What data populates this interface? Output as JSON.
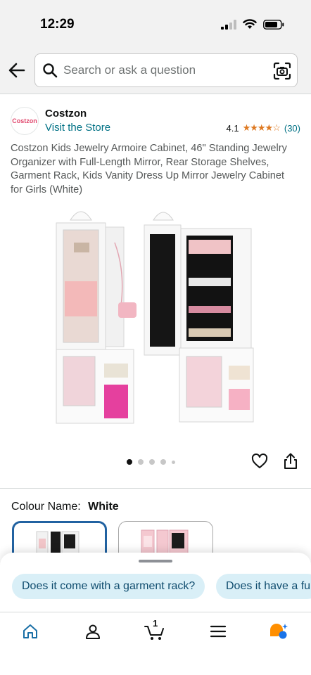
{
  "status_bar": {
    "time": "12:29"
  },
  "search": {
    "placeholder": "Search or ask a question"
  },
  "store": {
    "logo_text": "Costzon",
    "brand": "Costzon",
    "visit_label": "Visit the Store"
  },
  "rating": {
    "value": "4.1",
    "stars": "★★★★☆",
    "count": "(30)"
  },
  "product": {
    "title": "Costzon Kids Jewelry Armoire Cabinet, 46\" Standing Jewelry Organizer with Full-Length Mirror, Rear Storage Shelves, Garment Rack, Kids Vanity Dress Up Mirror Jewelry Cabinet for Girls (White)"
  },
  "carousel": {
    "total_dots": 5,
    "active_index": 0
  },
  "colour": {
    "label": "Colour Name:",
    "selected": "White",
    "options": [
      "White",
      "Pink"
    ]
  },
  "suggestions": [
    "Does it come with a garment rack?",
    "Does it have a fu"
  ],
  "tab_bar": {
    "items": [
      "home-icon",
      "account-icon",
      "cart-icon",
      "menu-icon",
      "rufus-icon"
    ],
    "cart_count": "1"
  },
  "colors": {
    "accent_blue": "#2162a1",
    "link": "#007185",
    "star": "#de7921",
    "chip_bg": "#d9eff7",
    "rufus_orange": "#ff8f00",
    "rufus_blue": "#1a73e8"
  }
}
